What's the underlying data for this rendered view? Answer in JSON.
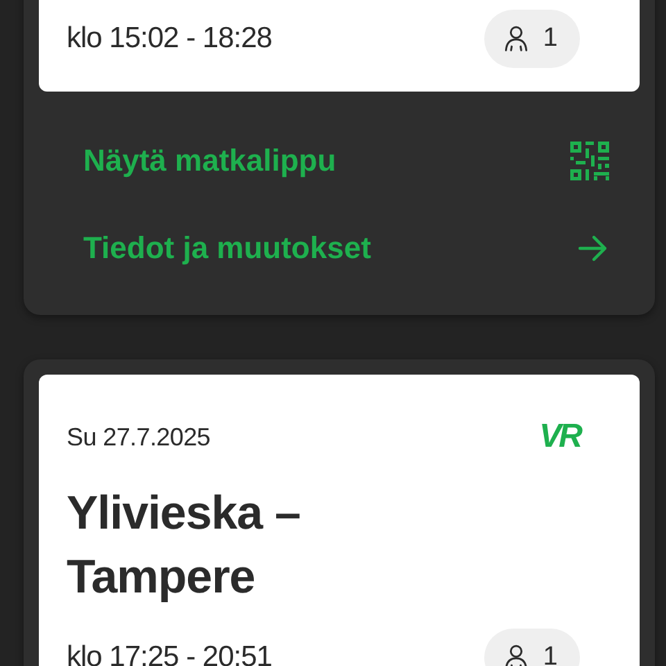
{
  "trips": [
    {
      "time": "klo 15:02 - 18:28",
      "passengers": "1",
      "actions": [
        {
          "label": "Näytä matkalippu",
          "kind": "qr"
        },
        {
          "label": "Tiedot ja muutokset",
          "kind": "arrow"
        }
      ]
    },
    {
      "date": "Su 27.7.2025",
      "logo": "VR",
      "title": "Ylivieska – Tampere",
      "time": "klo 17:25 - 20:51",
      "passengers": "1"
    }
  ]
}
